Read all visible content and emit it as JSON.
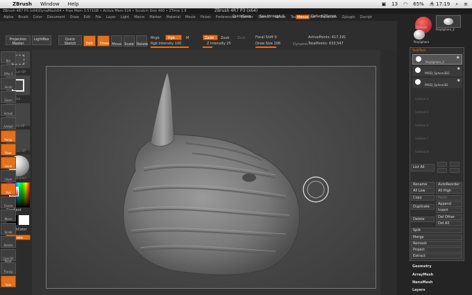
{
  "mac_menu": {
    "app_name": "ZBrush",
    "items": [
      "Window",
      "Help"
    ],
    "battery": "65%",
    "clock": "木 17:19",
    "wifi_label": "13"
  },
  "window": {
    "title": "ZBrush 4R7 P3 (x64)",
    "info": "ZBrush 4R7 P3 (x64)DynaMesh64 • Free Mem 3.571GB • Active Mem 524 • Scratch Disk 460 • ZTime 1.8",
    "quicksave": "QuickSave",
    "seethrough": "See-through 0",
    "menus_btn": "Menus",
    "default_zscript": "DefaultZScript"
  },
  "main_menu": [
    "Alpha",
    "Brush",
    "Color",
    "Document",
    "Draw",
    "Edit",
    "File",
    "Layer",
    "Light",
    "Macro",
    "Marker",
    "Material",
    "Movie",
    "Picker",
    "Preferences",
    "Render",
    "Stencil",
    "Stroke",
    "Texture",
    "Tool",
    "Transform",
    "Zplugin",
    "Zscript"
  ],
  "shelf": {
    "projection_master": "Projection Master",
    "lightbox": "LightBox",
    "quick_sketch": "Quick Sketch",
    "edit": "Edit",
    "draw": "Draw",
    "move": "Move",
    "scale": "Scale",
    "rotate": "Rotate",
    "mrgb": "Mrgb",
    "rgb": "Rgb",
    "m": "M",
    "rgb_intensity": "Rgb Intensity 100",
    "zadd": "Zadd",
    "zsub": "Zsub",
    "zcut": "Zcut",
    "z_intensity": "Z Intensity 25",
    "focal_shift": "Focal Shift 0",
    "draw_size": "Draw Size 106",
    "dynamic": "Dynamic",
    "active_points": "ActivePoints: 417,191",
    "total_points": "TotalPoints: 633,547"
  },
  "left_tray": {
    "texture_off": "Texture Off",
    "brush": "Std",
    "alpha_off": "Alpha Off",
    "texture_off2": "Texture Off",
    "material": "SkinShade4",
    "gradient": "Gradient",
    "switch_color": "SwitchColor",
    "alternate": "Alternate"
  },
  "right_tools": [
    "Bpr",
    "SPix 3",
    "Scroll",
    "Zoom",
    "Actual",
    "AAHalf",
    "Persp",
    "Floor",
    "Local",
    "LSym",
    "Xyz",
    "Frame",
    "Move",
    "Scale",
    "Rotate",
    "Line Fill PolyF",
    "Transp",
    "Dynamic",
    "Solo",
    "Xpose"
  ],
  "right_panel": {
    "sphere3d": "ZSphere",
    "polysphere": "PolySphere",
    "poly_sphere_2": "PolySphere_2",
    "subtool_title": "SubTool",
    "items": [
      "PolySphere_2",
      "PM3D_Sphere3D1",
      "PM3D_Sphere3D"
    ],
    "empty_slots": [
      "Subtool 4",
      "Subtool 5",
      "Subtool 6",
      "Subtool 7",
      "Subtool 8"
    ],
    "list_all": "List All",
    "rename": "Rename",
    "auto_reorder": "AutoReorder",
    "all_low": "All Low",
    "all_high": "All High",
    "copy": "Copy",
    "paste": "Paste",
    "append": "Append",
    "duplicate": "Duplicate",
    "insert": "Insert",
    "delete": "Delete",
    "del_other": "Del Other",
    "del_all": "Del All",
    "split": "Split",
    "merge": "Merge",
    "remesh": "Remesh",
    "project": "Project",
    "extract": "Extract",
    "geometry": "Geometry",
    "arraymesh": "ArrayMesh",
    "nanomesh": "NanoMesh",
    "layers": "Layers"
  },
  "colors": {
    "accent": "#e3701c",
    "panel": "#2f2f2f",
    "canvas": "#4a4a4a"
  }
}
